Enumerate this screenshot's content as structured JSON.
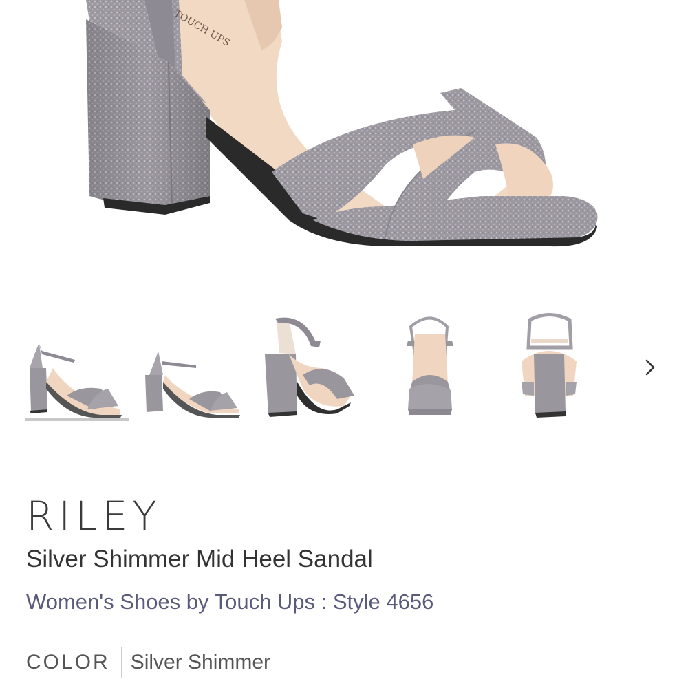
{
  "hero": {
    "image_name": "Silver Shimmer Mid Heel Sandal - main view",
    "insole_brand": "TOUCH UPS"
  },
  "thumbnails": [
    {
      "name": "side view",
      "selected": true
    },
    {
      "name": "side view small",
      "selected": false
    },
    {
      "name": "three-quarter view",
      "selected": false
    },
    {
      "name": "front view",
      "selected": false
    },
    {
      "name": "back view",
      "selected": false
    }
  ],
  "navigation": {
    "next_icon": "chevron-right-icon"
  },
  "product": {
    "name": "RILEY",
    "subtitle": "Silver Shimmer Mid Heel Sandal",
    "meta": "Women's Shoes by Touch Ups : Style 4656"
  },
  "color": {
    "label": "COLOR",
    "value": "Silver Shimmer"
  },
  "colors": {
    "shimmer": "#9a969c",
    "insole": "#f0d8c2",
    "sole": "#2a2a2a",
    "selected_bar": "#c8c8c8"
  }
}
